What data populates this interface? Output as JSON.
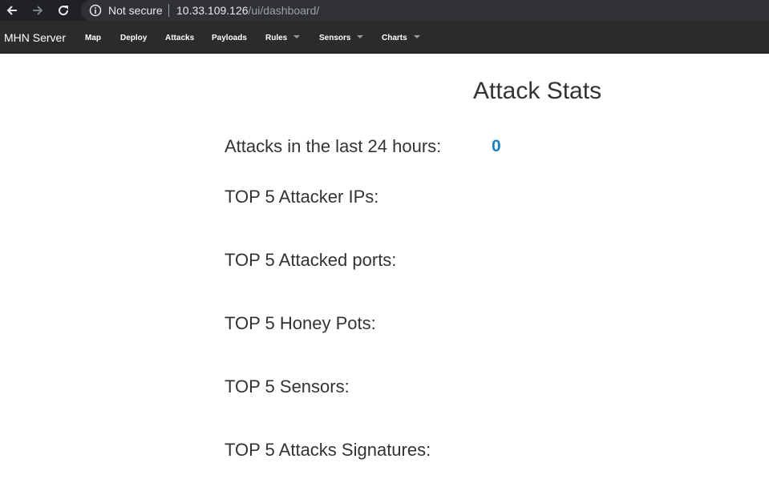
{
  "browser": {
    "security_label": "Not secure",
    "url_host": "10.33.109.126",
    "url_path": "/ui/dashboard/"
  },
  "navbar": {
    "brand": "MHN Server",
    "items": [
      {
        "label": "Map",
        "dropdown": false
      },
      {
        "label": "Deploy",
        "dropdown": false
      },
      {
        "label": "Attacks",
        "dropdown": false
      },
      {
        "label": "Payloads",
        "dropdown": false
      },
      {
        "label": "Rules",
        "dropdown": true
      },
      {
        "label": "Sensors",
        "dropdown": true
      },
      {
        "label": "Charts",
        "dropdown": true
      }
    ]
  },
  "main": {
    "title": "Attack Stats",
    "attacks_24h_label": "Attacks in the last 24 hours:",
    "attacks_24h_value": "0",
    "sections": [
      "TOP 5 Attacker IPs:",
      "TOP 5 Attacked ports:",
      "TOP 5 Honey Pots:",
      "TOP 5 Sensors:",
      "TOP 5 Attacks Signatures:"
    ]
  },
  "colors": {
    "navbar_bg": "#2b2b2b",
    "stat_value": "#1a82b8",
    "browser_bg": "#202124"
  }
}
